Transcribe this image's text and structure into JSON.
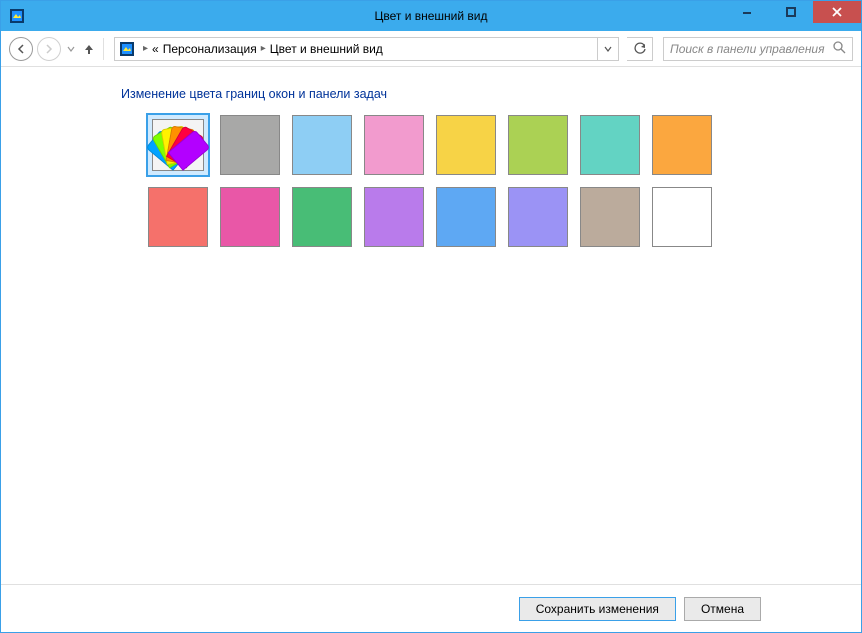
{
  "window": {
    "title": "Цвет и внешний вид"
  },
  "breadcrumb": {
    "prefix": "«",
    "items": [
      "Персонализация",
      "Цвет и внешний вид"
    ]
  },
  "search": {
    "placeholder": "Поиск в панели управления"
  },
  "heading": "Изменение цвета границ окон и панели задач",
  "colors": [
    {
      "name": "automatic",
      "value": "auto",
      "selected": true
    },
    {
      "name": "grey",
      "value": "#a8a8a7"
    },
    {
      "name": "sky",
      "value": "#8ecef4"
    },
    {
      "name": "pink",
      "value": "#f29bce"
    },
    {
      "name": "yellow",
      "value": "#f7d346"
    },
    {
      "name": "lime",
      "value": "#abd154"
    },
    {
      "name": "teal",
      "value": "#63d3c3"
    },
    {
      "name": "orange",
      "value": "#fba73f"
    },
    {
      "name": "coral",
      "value": "#f5716b"
    },
    {
      "name": "magenta",
      "value": "#e957a7"
    },
    {
      "name": "green",
      "value": "#48bd76"
    },
    {
      "name": "purple",
      "value": "#b97beb"
    },
    {
      "name": "blue",
      "value": "#5ea8f3"
    },
    {
      "name": "lavender",
      "value": "#9b93f5"
    },
    {
      "name": "taupe",
      "value": "#bbab9c"
    },
    {
      "name": "white",
      "value": "#ffffff"
    }
  ],
  "buttons": {
    "save": "Сохранить изменения",
    "cancel": "Отмена"
  }
}
